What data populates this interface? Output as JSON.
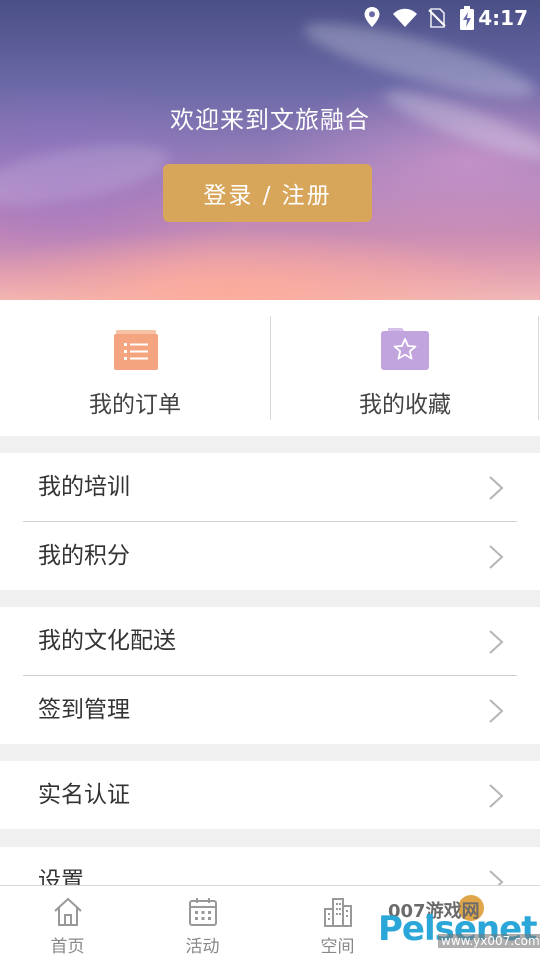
{
  "status_bar": {
    "time": "4:17",
    "icons": [
      "location-icon",
      "wifi-icon",
      "no-sim-icon",
      "battery-charging-icon"
    ]
  },
  "header": {
    "welcome_text": "欢迎来到文旅融合",
    "login_button": "登录 / 注册"
  },
  "quick_actions": [
    {
      "label": "我的订单",
      "icon": "orders-icon",
      "color": "#f4a47f"
    },
    {
      "label": "我的收藏",
      "icon": "favorites-icon",
      "color": "#c1a3dd"
    }
  ],
  "menu_groups": [
    {
      "items": [
        {
          "label": "我的培训"
        },
        {
          "label": "我的积分"
        }
      ]
    },
    {
      "items": [
        {
          "label": "我的文化配送"
        },
        {
          "label": "签到管理"
        }
      ]
    },
    {
      "items": [
        {
          "label": "实名认证"
        }
      ]
    },
    {
      "items": [
        {
          "label": "设置"
        }
      ]
    }
  ],
  "tab_bar": [
    {
      "label": "首页",
      "icon": "home-icon"
    },
    {
      "label": "活动",
      "icon": "calendar-icon"
    },
    {
      "label": "空间",
      "icon": "building-icon"
    }
  ],
  "watermark": {
    "text_top": "007游戏网",
    "brand": "Pelsenet",
    "url": "www.yx007.com"
  },
  "colors": {
    "accent": "#d8a65b",
    "background": "#f0f0f0"
  }
}
